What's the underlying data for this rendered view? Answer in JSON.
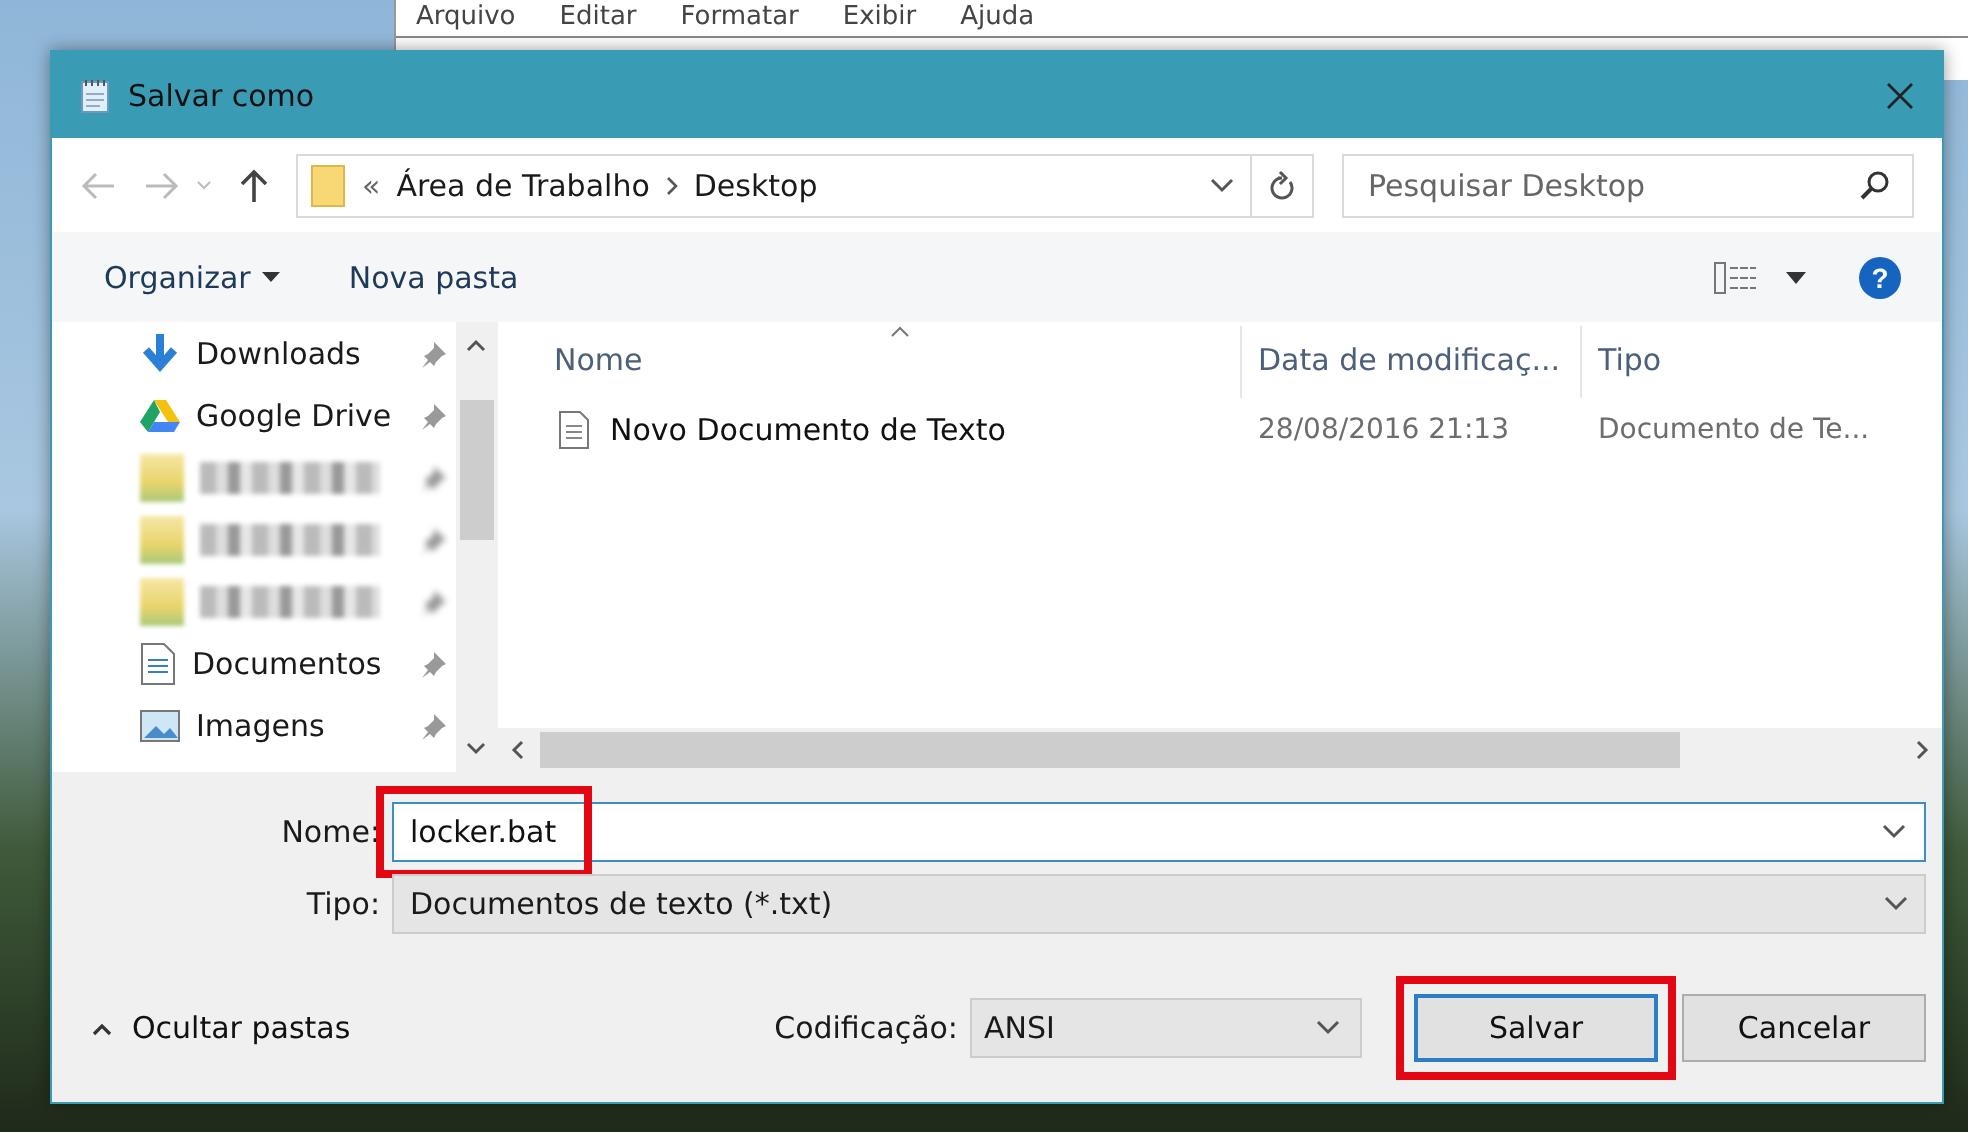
{
  "background_window": {
    "menu": [
      "Arquivo",
      "Editar",
      "Formatar",
      "Exibir",
      "Ajuda"
    ]
  },
  "window": {
    "title": "Salvar como"
  },
  "address_bar": {
    "overflow": "«",
    "segments": [
      "Área de Trabalho",
      "Desktop"
    ]
  },
  "search": {
    "placeholder": "Pesquisar Desktop"
  },
  "toolbar": {
    "organize": "Organizar",
    "new_folder": "Nova pasta",
    "help": "?"
  },
  "sidebar": {
    "items": [
      {
        "kind": "download",
        "label": "Downloads"
      },
      {
        "kind": "drive",
        "label": "Google Drive"
      },
      {
        "kind": "redacted"
      },
      {
        "kind": "redacted"
      },
      {
        "kind": "redacted"
      },
      {
        "kind": "documents",
        "label": "Documentos"
      },
      {
        "kind": "pictures",
        "label": "Imagens"
      }
    ]
  },
  "table": {
    "columns": [
      "Nome",
      "Data de modificaç...",
      "Tipo"
    ],
    "rows": [
      {
        "name": "Novo Documento de Texto",
        "date": "28/08/2016 21:13",
        "type": "Documento de Te..."
      }
    ]
  },
  "filename": {
    "label": "Nome:",
    "value": "locker.bat",
    "highlighted": true
  },
  "filetype": {
    "label": "Tipo:",
    "value": "Documentos de texto (*.txt)"
  },
  "hide_folders": "Ocultar pastas",
  "encoding": {
    "label": "Codificação:",
    "value": "ANSI"
  },
  "buttons": [
    {
      "kind": "primary",
      "label": "Salvar",
      "highlighted": true
    },
    {
      "kind": "secondary",
      "label": "Cancelar",
      "highlighted": false
    }
  ]
}
